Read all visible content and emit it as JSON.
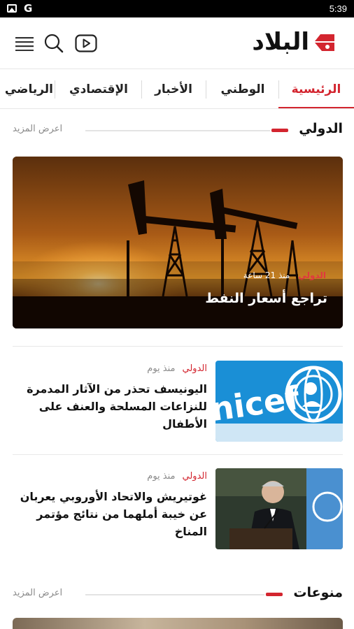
{
  "status_bar": {
    "time": "5:39",
    "g_icon": "G"
  },
  "header": {
    "logo_text": "البلاد",
    "brand_color": "#d3252f"
  },
  "tabs": [
    {
      "label": "الرئيسية",
      "active": true
    },
    {
      "label": "الوطني",
      "active": false
    },
    {
      "label": "الأخبار",
      "active": false
    },
    {
      "label": "الإقتصادي",
      "active": false
    },
    {
      "label": "الرياضي",
      "active": false
    }
  ],
  "sections": [
    {
      "title": "الدولي",
      "more_label": "اعرض المزيد"
    },
    {
      "title": "منوعات",
      "more_label": "اعرض المزيد"
    }
  ],
  "featured": {
    "category": "الدولي",
    "time": "منذ 21 ساعة",
    "title": "تراجع أسعار النفط",
    "image": "oil-pumpjacks-sunset"
  },
  "articles": [
    {
      "category": "الدولي",
      "time": "منذ يوم",
      "title": "اليونيسف تحذر من الآثار المدمرة للنزاعات المسلحة والعنف على الأطفال",
      "image": "unicef-logo"
    },
    {
      "category": "الدولي",
      "time": "منذ يوم",
      "title": "غوتيريش والاتحاد الأوروبي يعربان عن خيبة أملهما من نتائج مؤتمر المناخ",
      "image": "guterres-un-flag"
    }
  ]
}
